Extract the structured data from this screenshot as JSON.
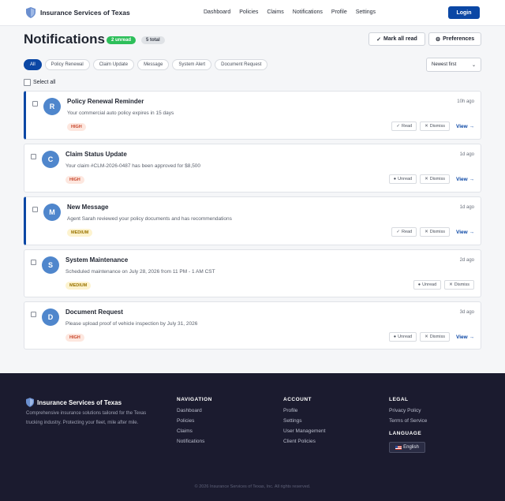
{
  "header": {
    "brand": "Insurance Services of Texas",
    "nav": [
      "Dashboard",
      "Policies",
      "Claims",
      "Notifications",
      "Profile",
      "Settings"
    ],
    "login_label": "Login"
  },
  "page": {
    "title": "Notifications",
    "unread_badge": "2 unread",
    "total_badge": "5 total",
    "mark_all_label": "Mark all read",
    "preferences_label": "Preferences",
    "filters": [
      "All",
      "Policy Renewal",
      "Claim Update",
      "Message",
      "System Alert",
      "Document Request"
    ],
    "active_filter": "All",
    "sort_value": "Newest first",
    "select_all_label": "Select all"
  },
  "notifications": [
    {
      "initial": "R",
      "title": "Policy Renewal Reminder",
      "message": "Your commercial auto policy expires in 15 days",
      "time": "10h ago",
      "priority": "HIGH",
      "toggle_label": "Read",
      "dismiss_label": "Dismiss",
      "view_label": "View →",
      "unread": true
    },
    {
      "initial": "C",
      "title": "Claim Status Update",
      "message": "Your claim #CLM-2026-0487 has been approved for $8,500",
      "time": "1d ago",
      "priority": "HIGH",
      "toggle_label": "Unread",
      "dismiss_label": "Dismiss",
      "view_label": "View →",
      "unread": false
    },
    {
      "initial": "M",
      "title": "New Message",
      "message": "Agent Sarah reviewed your policy documents and has recommendations",
      "time": "1d ago",
      "priority": "MEDIUM",
      "toggle_label": "Read",
      "dismiss_label": "Dismiss",
      "view_label": "View →",
      "unread": true
    },
    {
      "initial": "S",
      "title": "System Maintenance",
      "message": "Scheduled maintenance on July 28, 2026 from 11 PM - 1 AM CST",
      "time": "2d ago",
      "priority": "MEDIUM",
      "toggle_label": "Unread",
      "dismiss_label": "Dismiss",
      "view_label": "",
      "unread": false
    },
    {
      "initial": "D",
      "title": "Document Request",
      "message": "Please upload proof of vehicle inspection by July 31, 2026",
      "time": "3d ago",
      "priority": "HIGH",
      "toggle_label": "Unread",
      "dismiss_label": "Dismiss",
      "view_label": "View →",
      "unread": false
    }
  ],
  "footer": {
    "brand": "Insurance Services of Texas",
    "description": "Comprehensive insurance solutions tailored for the Texas trucking industry. Protecting your fleet, mile after mile.",
    "navigation": {
      "heading": "NAVIGATION",
      "links": [
        "Dashboard",
        "Policies",
        "Claims",
        "Notifications"
      ]
    },
    "account": {
      "heading": "ACCOUNT",
      "links": [
        "Profile",
        "Settings",
        "User Management",
        "Client Policies"
      ]
    },
    "legal": {
      "heading": "LEGAL",
      "links": [
        "Privacy Policy",
        "Terms of Service"
      ]
    },
    "language_heading": "LANGUAGE",
    "language_button": "English",
    "copyright": "© 2026 Insurance Services of Texas, Inc. All rights reserved."
  },
  "colors": {
    "primary": "#0b47a5",
    "unread_badge": "#2dbf5a",
    "avatar": "#4f86cc",
    "footer_bg": "#1b1b2f"
  }
}
